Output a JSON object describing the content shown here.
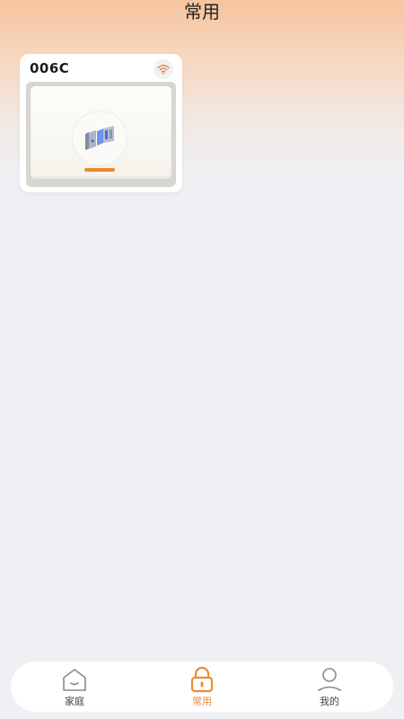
{
  "header": {
    "title": "常用"
  },
  "devices": [
    {
      "name": "006C",
      "status_icon": "wifi-icon",
      "image_icon": "smart-lock-icon"
    }
  ],
  "bottom_nav": {
    "items": [
      {
        "label": "家庭",
        "icon": "home-icon",
        "active": false
      },
      {
        "label": "常用",
        "icon": "lock-icon",
        "active": true
      },
      {
        "label": "我的",
        "icon": "person-icon",
        "active": false
      }
    ]
  },
  "colors": {
    "accent": "#ee8b2f",
    "header_gradient_top": "#f6c49d",
    "background": "#eff0f4"
  }
}
